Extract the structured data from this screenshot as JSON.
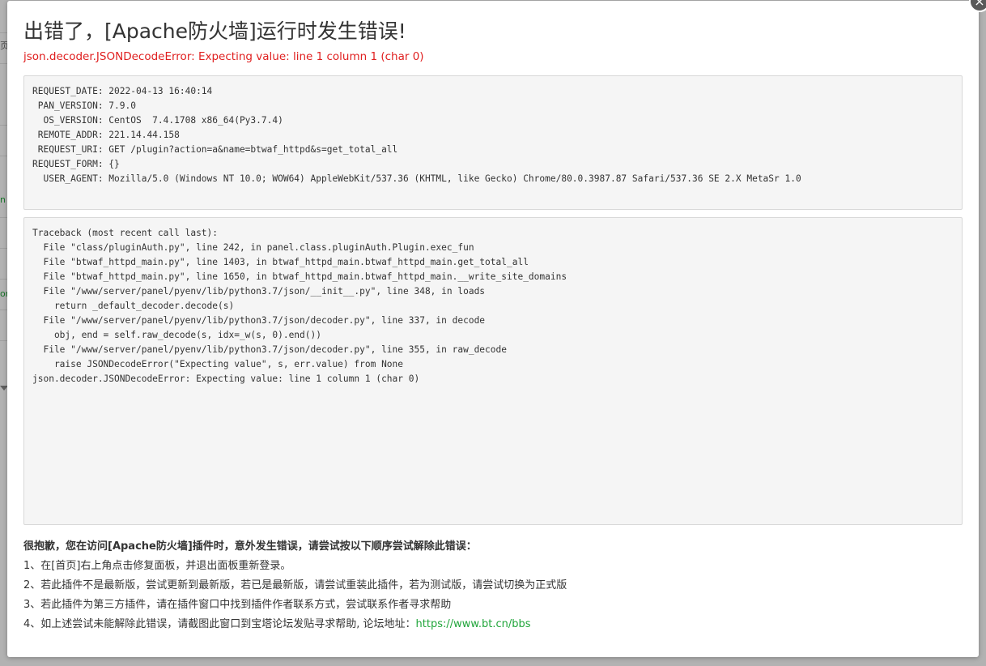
{
  "background": {
    "side_texts": [
      "页",
      "n",
      "on"
    ]
  },
  "dialog": {
    "close_label": "×",
    "title": "出错了，[Apache防火墙]运行时发生错误!",
    "error_message": "json.decoder.JSONDecodeError: Expecting value: line 1 column 1 (char 0)",
    "request_info": [
      "REQUEST_DATE: 2022-04-13 16:40:14",
      " PAN_VERSION: 7.9.0",
      "  OS_VERSION: CentOS  7.4.1708 x86_64(Py3.7.4)",
      " REMOTE_ADDR: 221.14.44.158",
      " REQUEST_URI: GET /plugin?action=a&name=btwaf_httpd&s=get_total_all",
      "REQUEST_FORM: {}",
      "  USER_AGENT: Mozilla/5.0 (Windows NT 10.0; WOW64) AppleWebKit/537.36 (KHTML, like Gecko) Chrome/80.0.3987.87 Safari/537.36 SE 2.X MetaSr 1.0"
    ],
    "traceback": [
      "Traceback (most recent call last):",
      "  File \"class/pluginAuth.py\", line 242, in panel.class.pluginAuth.Plugin.exec_fun",
      "  File \"btwaf_httpd_main.py\", line 1403, in btwaf_httpd_main.btwaf_httpd_main.get_total_all",
      "  File \"btwaf_httpd_main.py\", line 1650, in btwaf_httpd_main.btwaf_httpd_main.__write_site_domains",
      "  File \"/www/server/panel/pyenv/lib/python3.7/json/__init__.py\", line 348, in loads",
      "    return _default_decoder.decode(s)",
      "  File \"/www/server/panel/pyenv/lib/python3.7/json/decoder.py\", line 337, in decode",
      "    obj, end = self.raw_decode(s, idx=_w(s, 0).end())",
      "  File \"/www/server/panel/pyenv/lib/python3.7/json/decoder.py\", line 355, in raw_decode",
      "    raise JSONDecodeError(\"Expecting value\", s, err.value) from None",
      "json.decoder.JSONDecodeError: Expecting value: line 1 column 1 (char 0)"
    ],
    "help": {
      "title": "很抱歉，您在访问[Apache防火墙]插件时，意外发生错误，请尝试按以下顺序尝试解除此错误：",
      "step1": "1、在[首页]右上角点击修复面板，并退出面板重新登录。",
      "step2": "2、若此插件不是最新版，尝试更新到最新版，若已是最新版，请尝试重装此插件，若为测试版，请尝试切换为正式版",
      "step3": "3、若此插件为第三方插件，请在插件窗口中找到插件作者联系方式，尝试联系作者寻求帮助",
      "step4_text": "4、如上述尝试未能解除此错误，请截图此窗口到宝塔论坛发贴寻求帮助, 论坛地址：",
      "forum_link": "https://www.bt.cn/bbs"
    }
  },
  "colors": {
    "error_red": "#e02020",
    "link_green": "#20a53a",
    "code_bg": "#f5f5f5"
  }
}
